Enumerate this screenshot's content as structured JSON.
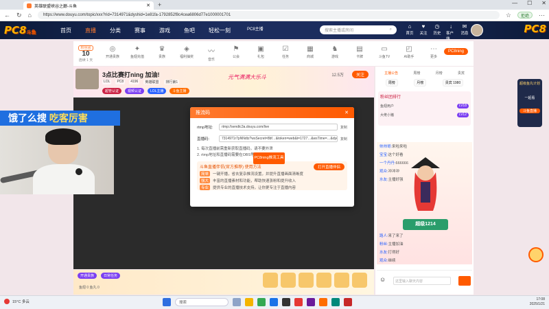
{
  "browser": {
    "tab_title": "英雄联盟峡谷之巅-斗鱼",
    "url": "https://www.douyu.com/topic/xxx?rid=7314971&dyshid=1e81fa-1792852f8c4cea6806d77e1000001701",
    "account_pill": "拒绝",
    "newtab": "+",
    "min": "—",
    "max": "☐",
    "close": "✕"
  },
  "header": {
    "logo": "PC8",
    "logo_sub": "斗鱼",
    "nav": [
      "首页",
      "直播",
      "分类",
      "赛事",
      "游戏",
      "鱼吧",
      "轻松一刻"
    ],
    "active_nav": 1,
    "center_label": "PC8主播",
    "search_placeholder": "搜索主播或房间",
    "icons": [
      {
        "name": "home-icon",
        "glyph": "⌂",
        "label": "首页"
      },
      {
        "name": "follow-icon",
        "glyph": "♥",
        "label": "关注"
      },
      {
        "name": "history-icon",
        "glyph": "◷",
        "label": "历史"
      },
      {
        "name": "download-icon",
        "glyph": "↓",
        "label": "客户端"
      },
      {
        "name": "message-icon",
        "glyph": "✉",
        "label": "消息"
      },
      {
        "name": "live-icon",
        "glyph": "▶",
        "label": "开播"
      }
    ],
    "logo_right": "PC8"
  },
  "toolbar": {
    "rank_level": "粉丝团",
    "rank_num": "10",
    "rank_desc": "连续 1 天",
    "tools": [
      {
        "name": "fans-icon",
        "glyph": "◎",
        "label": "开通贵族"
      },
      {
        "name": "gift-icon",
        "glyph": "✦",
        "label": "鱼翅充值"
      },
      {
        "name": "crown-icon",
        "glyph": "♛",
        "label": "贵族"
      },
      {
        "name": "lottery-icon",
        "glyph": "◈",
        "label": "福利抽奖"
      },
      {
        "name": "voice-icon",
        "glyph": "〰",
        "label": "音乐"
      },
      {
        "name": "guild-icon",
        "glyph": "⚑",
        "label": "公会"
      },
      {
        "name": "package-icon",
        "glyph": "▣",
        "label": "礼包"
      },
      {
        "name": "task-icon",
        "glyph": "☑",
        "label": "任务"
      },
      {
        "name": "shop-icon",
        "glyph": "▦",
        "label": "商城"
      },
      {
        "name": "game-icon",
        "glyph": "♞",
        "label": "游戏"
      },
      {
        "name": "card-icon",
        "glyph": "▤",
        "label": "卡牌"
      },
      {
        "name": "tv-icon",
        "glyph": "▭",
        "label": "斗鱼TV"
      },
      {
        "name": "ai-icon",
        "glyph": "◰",
        "label": "AI助手"
      },
      {
        "name": "more-icon",
        "glyph": "⋯",
        "label": "更多"
      }
    ],
    "ad_label": "PC8ning"
  },
  "room": {
    "title": "3点比赛打ning 加油!",
    "meta": [
      "LOL",
      "PC8",
      "4196",
      "英雄联盟",
      "排行第1"
    ],
    "tags": [
      "超管认证",
      "视频认证",
      "LOL主播",
      "斗鱼主播"
    ],
    "follow": "关注",
    "follow_count": "12.5万",
    "banner_text": "元气满满大乐斗"
  },
  "modal": {
    "title": "推流码",
    "close": "✕",
    "rows": [
      {
        "label": "rtmp地址:",
        "value": "rtmp://sendtc3a.douyu.com/live",
        "copy": "复制"
      },
      {
        "label": "直播码:",
        "value": "7314971r7pNNdtz?wsSecret=8bf…&token=web&t=1727…&wsTime=…&dycdn=…&.tidlsamp_id",
        "copy": "复制"
      }
    ],
    "notes": [
      "1. 每次直播前需重新获取直播码，请不要外泄",
      "2. rtmp地址和直播码需要在OBS等推流软件中使用"
    ],
    "center_button": "PC8ning推流工具",
    "promo_title": "斗鱼直播伴侣(官方推荐) 使用方法",
    "promo_button": "打开直播伴侣",
    "promo_lines": [
      {
        "tag": "简单",
        "text": "一键开播，省去复杂推流设置，并提升直播画面清晰度"
      },
      {
        "tag": "强大",
        "text": "丰富的直播素材和功能，帮助快速涨粉和提升收入"
      },
      {
        "tag": "专业",
        "text": "提供专业的直播技术支持，让你更专注于直播内容"
      }
    ]
  },
  "side": {
    "tabs": [
      "主播公告",
      "周榜",
      "月榜",
      "贵宾"
    ],
    "active_tab": 0,
    "ranks": [
      "周榜",
      "月榜",
      "贵宾 1980"
    ],
    "fan_title": "粉丝团排行",
    "fans": [
      {
        "name": "鱼翅用户",
        "badge": "LV18"
      },
      {
        "name": "大佬小猪",
        "badge": "LV12"
      }
    ],
    "chat": [
      {
        "user": "帅帅哥:",
        "text": "来啦来啦"
      },
      {
        "user": "宝宝:",
        "text": "这个好看"
      },
      {
        "user": "一个丹丹:",
        "text": "666666"
      },
      {
        "user": "观众:",
        "text": "冲冲冲"
      },
      {
        "user": "水友:",
        "text": "主播好强"
      }
    ],
    "pk_banner": "超级1214",
    "input_placeholder": "这里输入聊天内容",
    "more_chat": [
      {
        "user": "路人:",
        "text": "来了来了"
      },
      {
        "user": "粉丝:",
        "text": "主播加油"
      },
      {
        "user": "水友:",
        "text": "打得好"
      },
      {
        "user": "观众:",
        "text": "继续"
      }
    ]
  },
  "rail": {
    "top": "超级鱼丸计划",
    "mid": "一起看",
    "bottom": "斗鱼直播"
  },
  "under_video": {
    "btns": [
      "开通贵族",
      "日常任务"
    ],
    "wallet": "鱼翅 0  鱼丸 0"
  },
  "overlay_text": {
    "strip_a": "饿了么搜",
    "strip_b": "吃客厉害"
  },
  "taskbar": {
    "weather": "15°C 多云",
    "search": "搜索",
    "time": "17:08",
    "date": "2025/1/21"
  }
}
